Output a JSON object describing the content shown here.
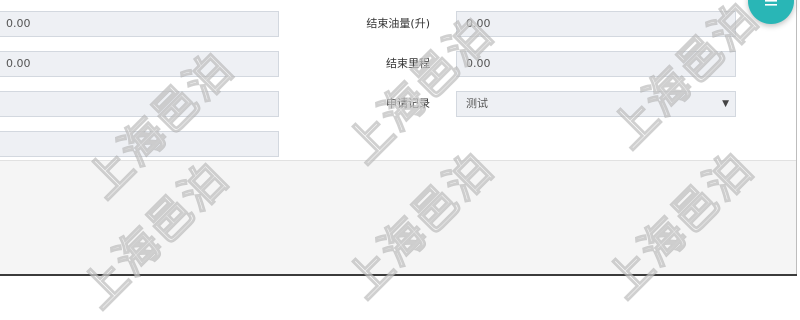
{
  "form": {
    "left_fields": [
      {
        "value": "0.00"
      },
      {
        "value": "0.00"
      },
      {
        "value": ""
      },
      {
        "value": ""
      }
    ],
    "end_fuel": {
      "label": "结束油量(升)",
      "value": "0.00"
    },
    "end_mileage": {
      "label": "结束里程",
      "value": "0.00"
    },
    "application_record": {
      "label": "申请记录",
      "selected": "测试"
    }
  },
  "watermark": {
    "text": "上海邑泊"
  },
  "colors": {
    "fab": "#29b6b6",
    "field_bg": "#eef0f4"
  },
  "icons": {
    "fab_icon": "list-icon",
    "dropdown": "caret-down-icon"
  }
}
